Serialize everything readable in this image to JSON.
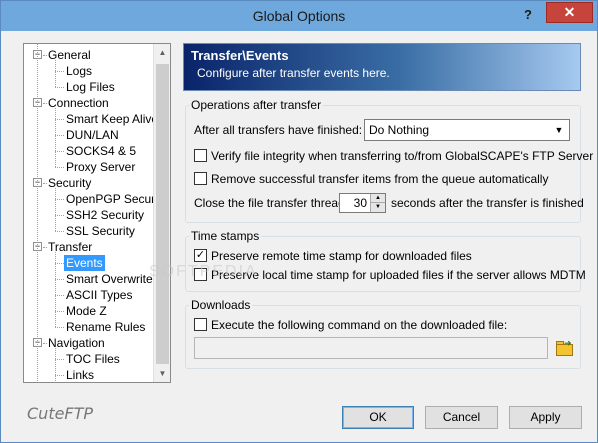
{
  "window": {
    "title": "Global Options",
    "help_label": "?",
    "close_label": "✕"
  },
  "tree": {
    "items": [
      {
        "label": "General",
        "level": 0,
        "expanded": true
      },
      {
        "label": "Logs",
        "level": 1
      },
      {
        "label": "Log Files",
        "level": 1
      },
      {
        "label": "Connection",
        "level": 0,
        "expanded": true
      },
      {
        "label": "Smart Keep Alive",
        "level": 1
      },
      {
        "label": "DUN/LAN",
        "level": 1
      },
      {
        "label": "SOCKS4 & 5",
        "level": 1
      },
      {
        "label": "Proxy Server",
        "level": 1
      },
      {
        "label": "Security",
        "level": 0,
        "expanded": true
      },
      {
        "label": "OpenPGP Security",
        "level": 1
      },
      {
        "label": "SSH2 Security",
        "level": 1
      },
      {
        "label": "SSL Security",
        "level": 1
      },
      {
        "label": "Transfer",
        "level": 0,
        "expanded": true
      },
      {
        "label": "Events",
        "level": 1,
        "selected": true
      },
      {
        "label": "Smart Overwrite",
        "level": 1
      },
      {
        "label": "ASCII Types",
        "level": 1
      },
      {
        "label": "Mode Z",
        "level": 1
      },
      {
        "label": "Rename Rules",
        "level": 1
      },
      {
        "label": "Navigation",
        "level": 0,
        "expanded": true
      },
      {
        "label": "TOC Files",
        "level": 1
      },
      {
        "label": "Links",
        "level": 1
      }
    ],
    "expander_symbol": "−"
  },
  "brand": "CuteFTP",
  "banner": {
    "title": "Transfer\\Events",
    "subtitle": "Configure after transfer events here."
  },
  "operations": {
    "group_label": "Operations after transfer",
    "after_all_label": "After all transfers have finished:",
    "after_all_value": "Do Nothing",
    "verify_label": "Verify file integrity when transferring to/from GlobalSCAPE's FTP Server",
    "verify_checked": false,
    "remove_label": "Remove successful transfer items from the queue automatically",
    "remove_checked": false,
    "close_thread_prefix": "Close the file transfer thread",
    "close_thread_value": "30",
    "close_thread_suffix": "seconds after the transfer is finished"
  },
  "timestamps": {
    "group_label": "Time stamps",
    "preserve_remote_label": "Preserve remote time stamp for downloaded files",
    "preserve_remote_checked": true,
    "preserve_local_label": "Preserve local time stamp for uploaded files if the server allows MDTM",
    "preserve_local_checked": false
  },
  "downloads": {
    "group_label": "Downloads",
    "execute_label": "Execute the following command on the downloaded file:",
    "execute_checked": false,
    "command_value": ""
  },
  "buttons": {
    "ok": "OK",
    "cancel": "Cancel",
    "apply": "Apply"
  },
  "watermark": "SOFTPEDIA",
  "check_mark": "✓"
}
